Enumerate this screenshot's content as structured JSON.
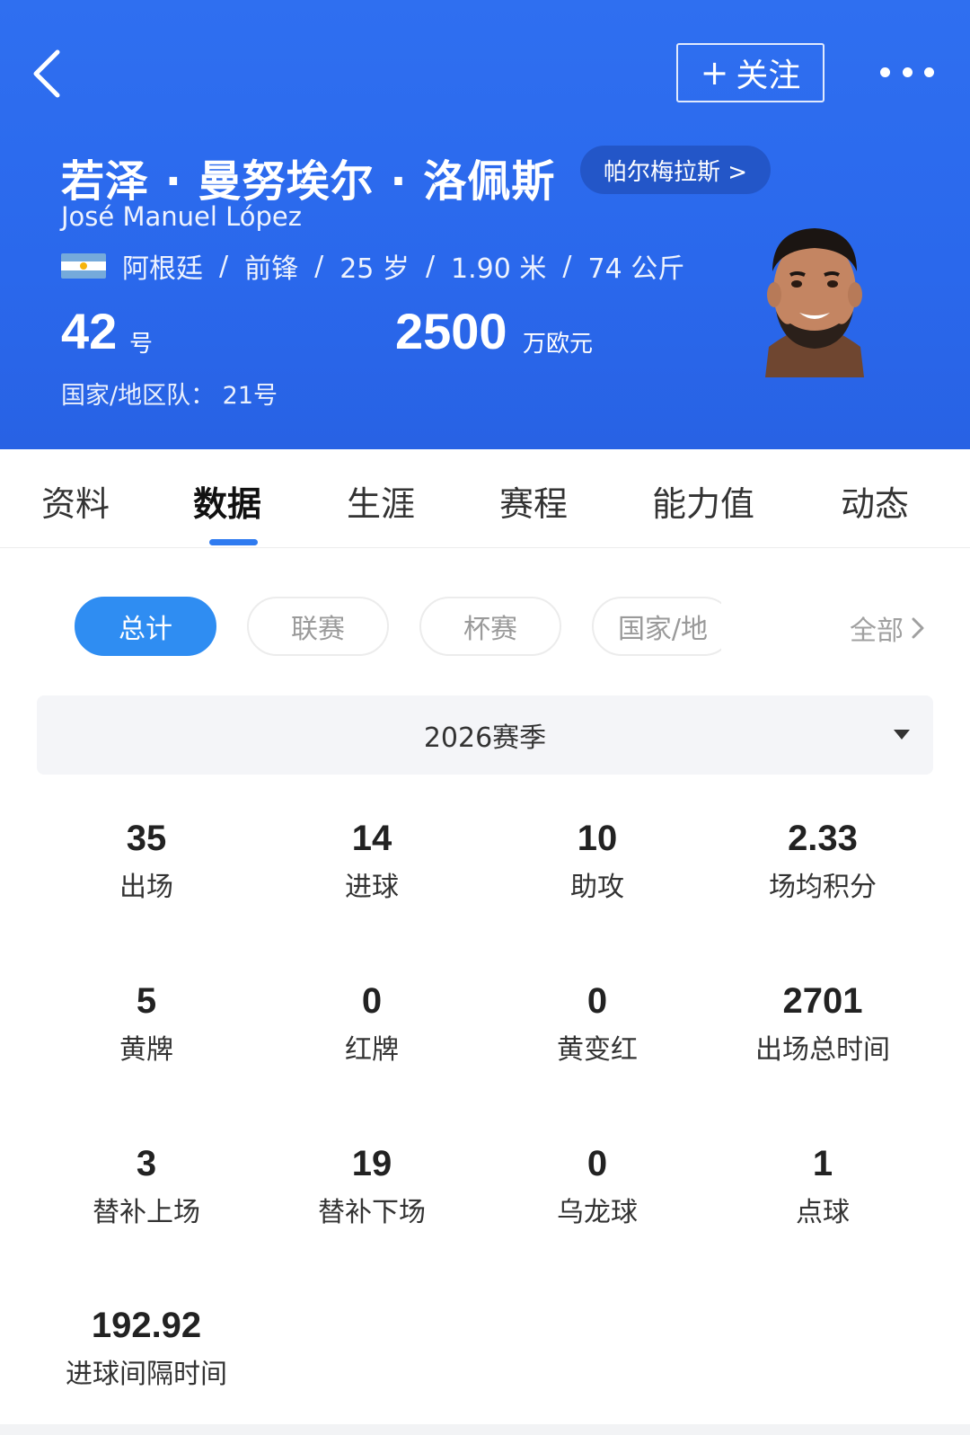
{
  "header": {
    "follow_label": "关注",
    "player_name": "若泽 · 曼努埃尔 · 洛佩斯",
    "club_label": "帕尔梅拉斯 >",
    "player_name_latin": "José Manuel López",
    "info": {
      "nationality": "阿根廷",
      "position": "前锋",
      "age": "25 岁",
      "height": "1.90 米",
      "weight": "74 公斤",
      "separator": "/"
    },
    "shirt_number": "42",
    "shirt_unit": "号",
    "market_value": "2500",
    "market_value_unit": "万欧元",
    "national_team": "国家/地区队： 21号"
  },
  "tabs": [
    "资料",
    "数据",
    "生涯",
    "赛程",
    "能力值",
    "动态"
  ],
  "active_tab": "数据",
  "filters": {
    "chips": [
      "总计",
      "联赛",
      "杯赛",
      "国家/地"
    ],
    "active": "总计",
    "all_label": "全部"
  },
  "season": {
    "selected": "2026赛季"
  },
  "stats": [
    {
      "value": "35",
      "label": "出场"
    },
    {
      "value": "14",
      "label": "进球"
    },
    {
      "value": "10",
      "label": "助攻"
    },
    {
      "value": "2.33",
      "label": "场均积分"
    },
    {
      "value": "5",
      "label": "黄牌"
    },
    {
      "value": "0",
      "label": "红牌"
    },
    {
      "value": "0",
      "label": "黄变红"
    },
    {
      "value": "2701",
      "label": "出场总时间"
    },
    {
      "value": "3",
      "label": "替补上场"
    },
    {
      "value": "19",
      "label": "替补下场"
    },
    {
      "value": "0",
      "label": "乌龙球"
    },
    {
      "value": "1",
      "label": "点球"
    },
    {
      "value": "192.92",
      "label": "进球间隔时间"
    }
  ],
  "colors": {
    "header_blue": "#2f6ff0",
    "accent_blue": "#2f8df2",
    "tab_indicator": "#2f7bf0"
  },
  "icons": [
    "back-arrow-icon",
    "plus-icon",
    "more-dots-icon",
    "argentina-flag-icon",
    "chevron-right-icon",
    "caret-down-icon"
  ]
}
